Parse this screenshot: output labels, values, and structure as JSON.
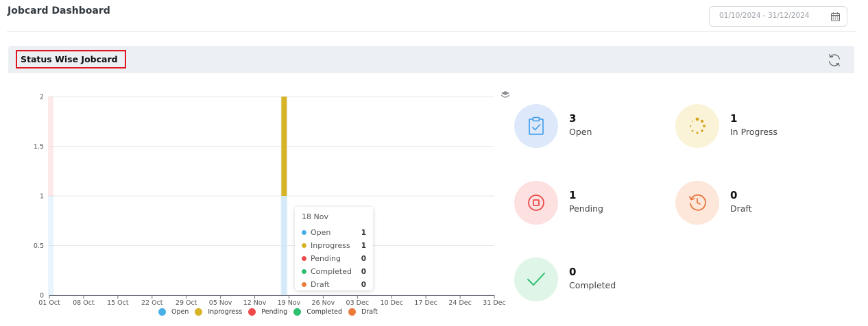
{
  "header": {
    "title": "Jobcard Dashboard",
    "date_range_placeholder": "01/10/2024 - 31/12/2024"
  },
  "card": {
    "title": "Status Wise Jobcard"
  },
  "colors": {
    "open": "#4aaee8",
    "inprogress": "#d6b425",
    "pending": "#ef4a4a",
    "completed": "#2fbf71",
    "draft": "#ec7a3a"
  },
  "chart_data": {
    "type": "bar",
    "stacked": true,
    "x_ticks": [
      "01 Oct",
      "08 Oct",
      "15 Oct",
      "22 Oct",
      "29 Oct",
      "05 Nov",
      "12 Nov",
      "19 Nov",
      "26 Nov",
      "03 Dec",
      "10 Dec",
      "17 Dec",
      "24 Dec",
      "31 Dec"
    ],
    "y_ticks": [
      "0",
      "0.5",
      "1",
      "1.5",
      "2"
    ],
    "ylim": [
      0,
      2
    ],
    "grid": true,
    "legend_position": "bottom",
    "series": [
      {
        "name": "Open",
        "points": [
          {
            "x": "2024-10-01",
            "y": 1
          },
          {
            "x": "2024-11-18",
            "y": 1
          }
        ]
      },
      {
        "name": "Inprogress",
        "points": [
          {
            "x": "2024-11-18",
            "y": 1
          }
        ]
      },
      {
        "name": "Pending",
        "points": [
          {
            "x": "2024-10-01",
            "y": 1
          }
        ]
      },
      {
        "name": "Completed",
        "points": []
      },
      {
        "name": "Draft",
        "points": []
      }
    ]
  },
  "tooltip": {
    "date": "18 Nov",
    "rows": [
      {
        "label": "Open",
        "value": "1"
      },
      {
        "label": "Inprogress",
        "value": "1"
      },
      {
        "label": "Pending",
        "value": "0"
      },
      {
        "label": "Completed",
        "value": "0"
      },
      {
        "label": "Draft",
        "value": "0"
      }
    ]
  },
  "legend": [
    "Open",
    "Inprogress",
    "Pending",
    "Completed",
    "Draft"
  ],
  "stats": [
    {
      "count": "3",
      "label": "Open",
      "icon": "clipboard-check-icon"
    },
    {
      "count": "1",
      "label": "In Progress",
      "icon": "spinner-icon"
    },
    {
      "count": "1",
      "label": "Pending",
      "icon": "stop-circle-icon"
    },
    {
      "count": "0",
      "label": "Draft",
      "icon": "history-clock-icon"
    },
    {
      "count": "0",
      "label": "Completed",
      "icon": "checkmark-icon"
    }
  ]
}
